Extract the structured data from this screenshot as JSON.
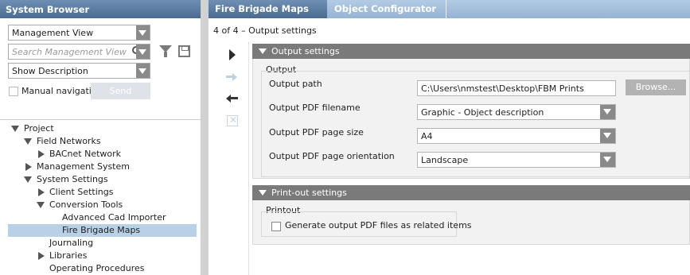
{
  "left_panel": {
    "title": "System Browser",
    "view_combo": "Management View",
    "search_placeholder": "Search Management View",
    "description_combo": "Show Description",
    "manual_navigation_label": "Manual navigatic",
    "send_label": "Send"
  },
  "tree": [
    {
      "label": "Project",
      "expander": "expanded"
    },
    {
      "label": "Field Networks",
      "expander": "expanded"
    },
    {
      "label": "BACnet Network",
      "expander": "collapsed"
    },
    {
      "label": "Management System",
      "expander": "collapsed"
    },
    {
      "label": "System Settings",
      "expander": "expanded"
    },
    {
      "label": "Client Settings",
      "expander": "collapsed"
    },
    {
      "label": "Conversion Tools",
      "expander": "expanded"
    },
    {
      "label": "Advanced Cad Importer",
      "expander": "none"
    },
    {
      "label": "Fire Brigade Maps",
      "expander": "none",
      "selected": true
    },
    {
      "label": "Journaling",
      "expander": "none"
    },
    {
      "label": "Libraries",
      "expander": "collapsed"
    },
    {
      "label": "Operating Procedures",
      "expander": "none"
    }
  ],
  "tabs": [
    {
      "label": "Fire Brigade Maps",
      "active": true
    },
    {
      "label": "Object Configurator",
      "active": false
    }
  ],
  "wizard": {
    "step_title": "4 of 4 – Output settings",
    "icons": [
      "play-icon",
      "forward-arrow-icon",
      "back-arrow-icon",
      "cancel-icon"
    ]
  },
  "output_settings": {
    "header": "Output settings",
    "group_title": "Output",
    "path_label": "Output path",
    "path_value": "C:\\Users\\nmstest\\Desktop\\FBM Prints",
    "browse_label": "Browse...",
    "filename_label": "Output PDF filename",
    "filename_value": "Graphic - Object description",
    "page_size_label": "Output PDF page size",
    "page_size_value": "A4",
    "orientation_label": "Output PDF page orientation",
    "orientation_value": "Landscape"
  },
  "printout_settings": {
    "header": "Print-out settings",
    "group_title": "Printout",
    "generate_label": "Generate output PDF files as related items",
    "generate_checked": false
  },
  "colors": {
    "title_bar": "#4a6a91",
    "tab_bar": "#95b3d4",
    "section_header": "#7a7a7a",
    "selection": "#b9d1e6"
  }
}
